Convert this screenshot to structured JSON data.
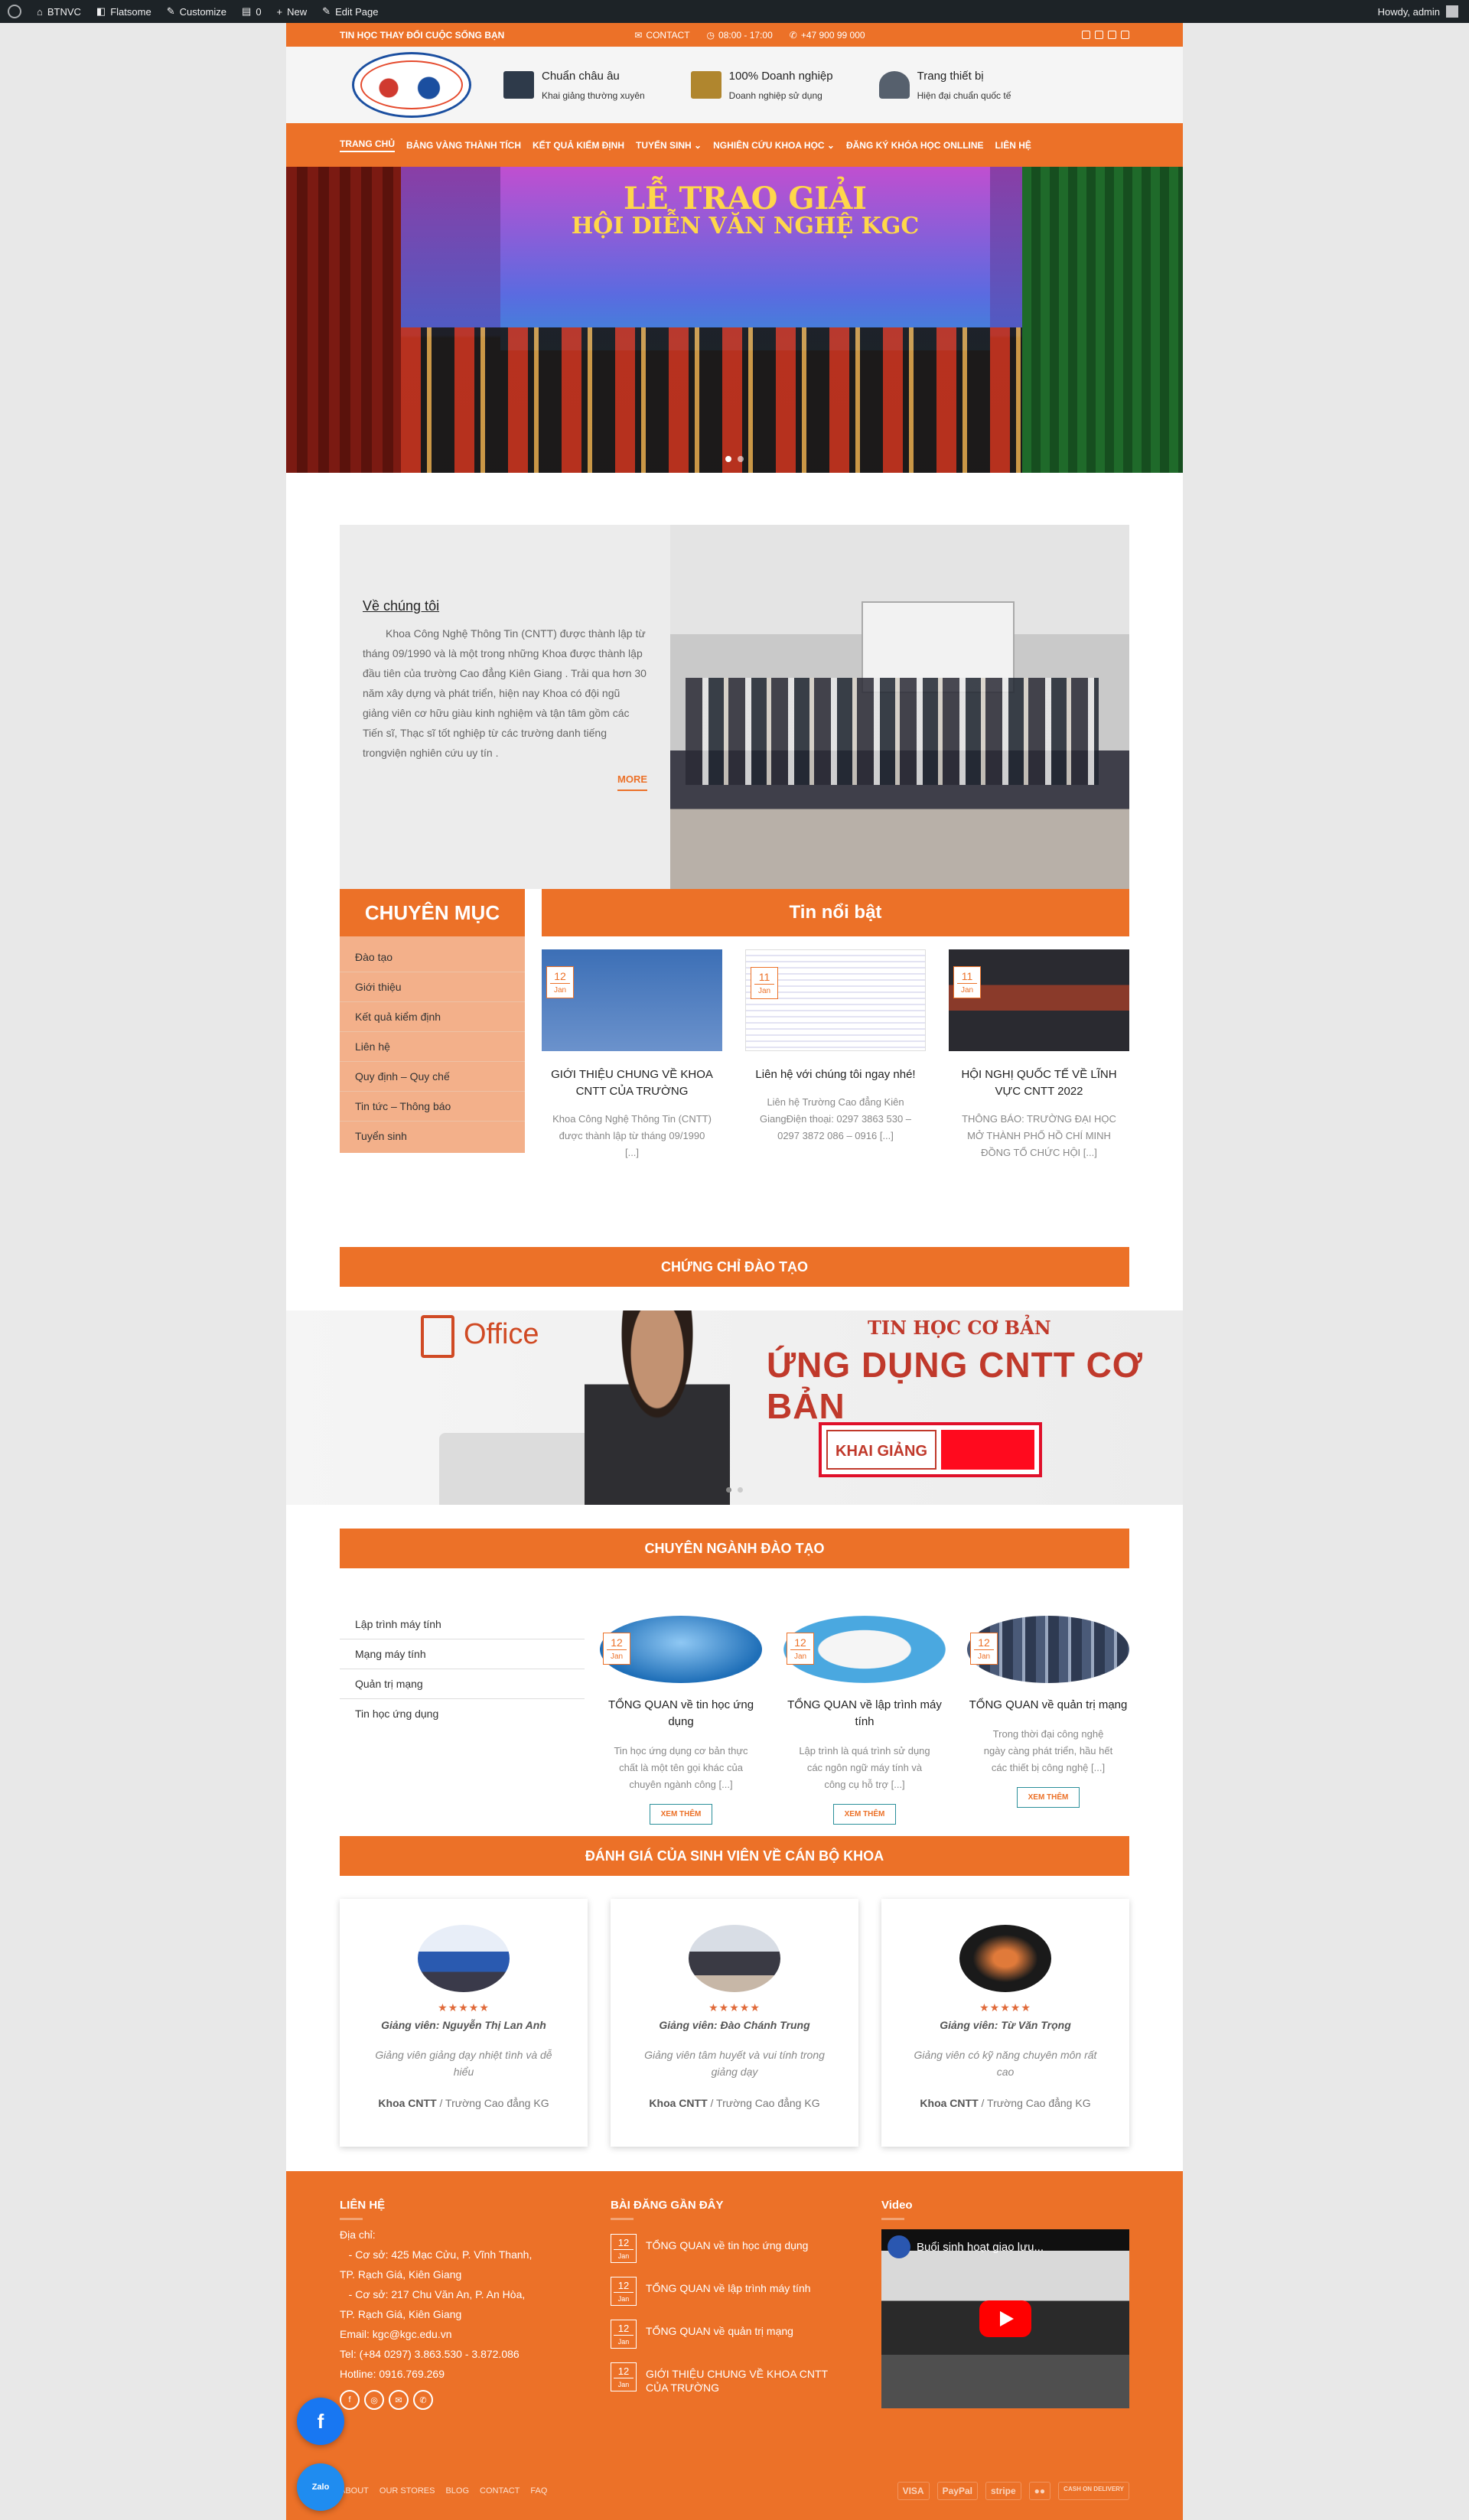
{
  "adminbar": {
    "site": "BTNVC",
    "theme": "Flatsome",
    "customize": "Customize",
    "comments": "0",
    "new": "New",
    "edit": "Edit Page",
    "howdy": "Howdy, admin"
  },
  "topbar": {
    "tagline": "TIN HỌC THAY ĐỔI CUỘC SỐNG BẠN",
    "contact": "CONTACT",
    "hours": "08:00 - 17:00",
    "phone": "+47 900 99 000"
  },
  "header": {
    "features": [
      {
        "title": "Chuẩn châu âu",
        "sub": "Khai giảng thường xuyên",
        "icon": "school-building-icon"
      },
      {
        "title": "100% Doanh nghiệp",
        "sub": "Doanh nghiệp sử dụng",
        "icon": "factory-icon"
      },
      {
        "title": "Trang thiết bị",
        "sub": "Hiện đại chuẩn quốc tế",
        "icon": "microscope-icon"
      }
    ]
  },
  "nav": [
    {
      "label": "TRANG CHỦ"
    },
    {
      "label": "BẢNG VÀNG THÀNH TÍCH"
    },
    {
      "label": "KẾT QUẢ KIỂM ĐỊNH"
    },
    {
      "label": "TUYỂN SINH ⌄"
    },
    {
      "label": "NGHIÊN CỨU KHOA HỌC ⌄"
    },
    {
      "label": "ĐĂNG KÝ KHÓA HỌC ONLLINE"
    },
    {
      "label": "LIÊN HỆ"
    }
  ],
  "hero": {
    "line1": "LỄ TRAO GIẢI",
    "line2": "HỘI DIỄN VĂN NGHỆ KGC"
  },
  "about": {
    "title": "Về chúng tôi",
    "text": "Khoa Công Nghệ Thông Tin (CNTT) được thành lập từ tháng 09/1990 và là một trong những Khoa được thành lập đầu tiên của trường Cao đẳng Kiên Giang . Trải qua hơn 30 năm xây dựng và phát triển, hiện nay Khoa có đội ngũ giảng viên cơ hữu giàu kinh nghiệm và tận tâm gồm các Tiến sĩ, Thạc sĩ tốt nghiệp từ các trường danh tiếng trongviện nghiên cứu uy tín .",
    "more": "MORE"
  },
  "categories": {
    "title": "CHUYÊN MỤC",
    "items": [
      "Đào tạo",
      "Giới thiệu",
      "Kết quả kiểm định",
      "Liên hệ",
      "Quy định – Quy chế",
      "Tin tức – Thông báo",
      "Tuyển sinh"
    ]
  },
  "featured": {
    "title": "Tin nổi bật",
    "cards": [
      {
        "day": "12",
        "month": "Jan",
        "title": "GIỚI THIỆU CHUNG VỀ KHOA CNTT CỦA TRƯỜNG",
        "excerpt": "Khoa Công Nghệ Thông Tin (CNTT) được thành lập từ tháng 09/1990 [...]"
      },
      {
        "day": "11",
        "month": "Jan",
        "title": "Liên hệ với chúng tôi ngay nhé!",
        "excerpt": "Liên hệ Trường Cao đẳng Kiên GiangĐiện thoại: 0297 3863 530 – 0297 3872 086 – 0916 [...]"
      },
      {
        "day": "11",
        "month": "Jan",
        "title": "HỘI NGHỊ QUỐC TẾ VỀ LĨNH VỰC CNTT 2022",
        "excerpt": "THÔNG BÁO: TRƯỜNG ĐẠI HỌC MỞ THÀNH PHỐ HỒ CHÍ MINH ĐỒNG TỔ CHỨC HỘI [...]"
      }
    ]
  },
  "certificates": {
    "title": "CHỨNG CHỈ ĐÀO TẠO",
    "banner": {
      "office": "Office",
      "small": "TIN HỌC CƠ BẢN",
      "big": "ỨNG DỤNG CNTT CƠ BẢN",
      "badge": "KHAI GIẢNG"
    }
  },
  "majors": {
    "title": "CHUYÊN NGÀNH ĐÀO TẠO",
    "list": [
      "Lập trình máy tính",
      "Mạng máy tính",
      "Quản trị mạng",
      "Tin học ứng dụng"
    ],
    "cards": [
      {
        "day": "12",
        "month": "Jan",
        "title": "TỔNG QUAN về tin học ứng dụng",
        "excerpt": "Tin học ứng dụng cơ bản thực chất là một tên gọi khác của chuyên ngành công [...]",
        "button": "XEM THÊM"
      },
      {
        "day": "12",
        "month": "Jan",
        "title": "TỔNG QUAN về lập trình máy tính",
        "excerpt": "Lập trình là quá trình sử dụng các ngôn ngữ máy tính và công cụ hỗ trợ [...]",
        "button": "XEM THÊM"
      },
      {
        "day": "12",
        "month": "Jan",
        "title": "TỔNG QUAN về quản trị mạng",
        "excerpt": "Trong thời đại công nghệ ngày càng phát triển, hầu hết các thiết bị công nghệ [...]",
        "button": "XEM THÊM"
      }
    ]
  },
  "reviews": {
    "title": "ĐÁNH GIÁ CỦA SINH VIÊN VỀ CÁN BỘ KHOA",
    "items": [
      {
        "stars": "★★★★★",
        "name": "Giảng viên: Nguyễn Thị Lan Anh",
        "quote": "Giảng viên giảng dạy nhiệt tình và dễ hiểu",
        "org": "Khoa CNTT",
        "school": " / Trường Cao đẳng KG"
      },
      {
        "stars": "★★★★★",
        "name": "Giảng viên: Đào Chánh Trung",
        "quote": "Giảng viên tâm huyết và vui tính trong giảng dạy",
        "org": "Khoa CNTT",
        "school": " / Trường Cao đẳng KG"
      },
      {
        "stars": "★★★★★",
        "name": "Giảng viên: Từ Văn Trọng",
        "quote": "Giảng viên có kỹ năng chuyên môn rất cao",
        "org": "Khoa CNTT",
        "school": " / Trường Cao đẳng KG"
      }
    ]
  },
  "footer": {
    "contact_title": "LIÊN HỆ",
    "contact_lines": [
      "Địa chỉ:",
      "   - Cơ sở: 425 Mạc Cửu, P. Vĩnh Thanh,",
      "TP. Rạch Giá, Kiên Giang",
      "   - Cơ sở: 217 Chu Văn An, P. An Hòa,",
      "TP. Rạch Giá, Kiên Giang",
      "Email: kgc@kgc.edu.vn",
      "Tel: (+84 0297) 3.863.530 - 3.872.086",
      "Hotline: 0916.769.269"
    ],
    "recent_title": "BÀI ĐĂNG GẦN ĐÂY",
    "recent": [
      {
        "day": "12",
        "month": "Jan",
        "title": "TỔNG QUAN về tin học ứng dụng"
      },
      {
        "day": "12",
        "month": "Jan",
        "title": "TỔNG QUAN về lập trình máy tính"
      },
      {
        "day": "12",
        "month": "Jan",
        "title": "TỔNG QUAN về quản trị mạng"
      },
      {
        "day": "12",
        "month": "Jan",
        "title": "GIỚI THIỆU CHUNG VỀ KHOA CNTT CỦA TRƯỜNG"
      }
    ],
    "video_title": "Video",
    "video_caption": "Buổi sinh hoạt giao lưu...",
    "bottom_links": [
      "ABOUT",
      "OUR STORES",
      "BLOG",
      "CONTACT",
      "FAQ"
    ],
    "payments": [
      "VISA",
      "PayPal",
      "stripe",
      "●●",
      "CASH ON DELIVERY"
    ]
  },
  "floating": {
    "facebook": "f",
    "zalo": "Zalo"
  }
}
